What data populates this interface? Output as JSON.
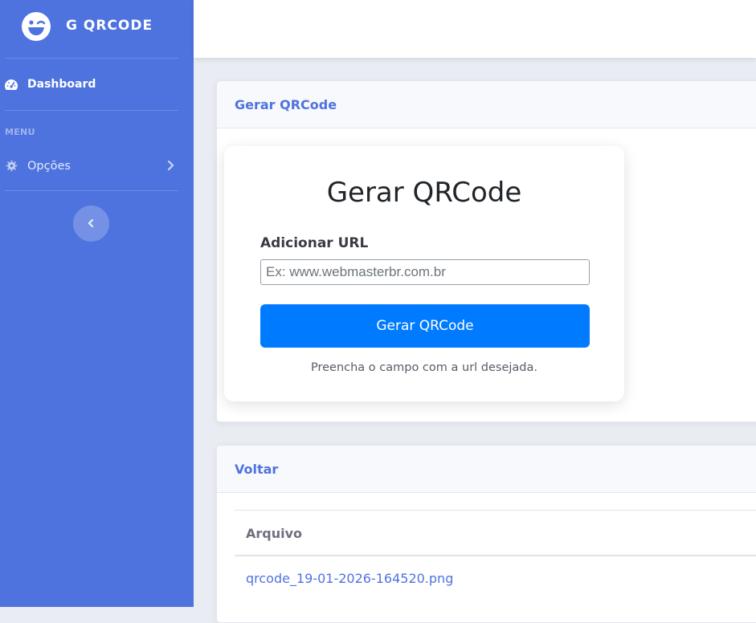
{
  "sidebar": {
    "brand": "G QRCODE",
    "brand_icon": "laugh-wink-icon",
    "dashboard_label": "Dashboard",
    "dashboard_icon": "tachometer-icon",
    "menu_heading": "MENU",
    "options_label": "Opções",
    "options_icon": "cog-icon",
    "background_color": "#4e73df"
  },
  "cards": {
    "generate": {
      "header": "Gerar QRCode",
      "title": "Gerar QRCode",
      "field_label": "Adicionar URL",
      "input_value": "",
      "input_placeholder": "Ex: www.webmasterbr.com.br",
      "button_label": "Gerar QRCode",
      "hint": "Preencha o campo com a url desejada."
    },
    "files": {
      "header": "Voltar",
      "column_header": "Arquivo",
      "rows": [
        "qrcode_19-01-2026-164520.png"
      ]
    }
  },
  "colors": {
    "primary_button": "#007bff",
    "accent": "#4e73df"
  }
}
